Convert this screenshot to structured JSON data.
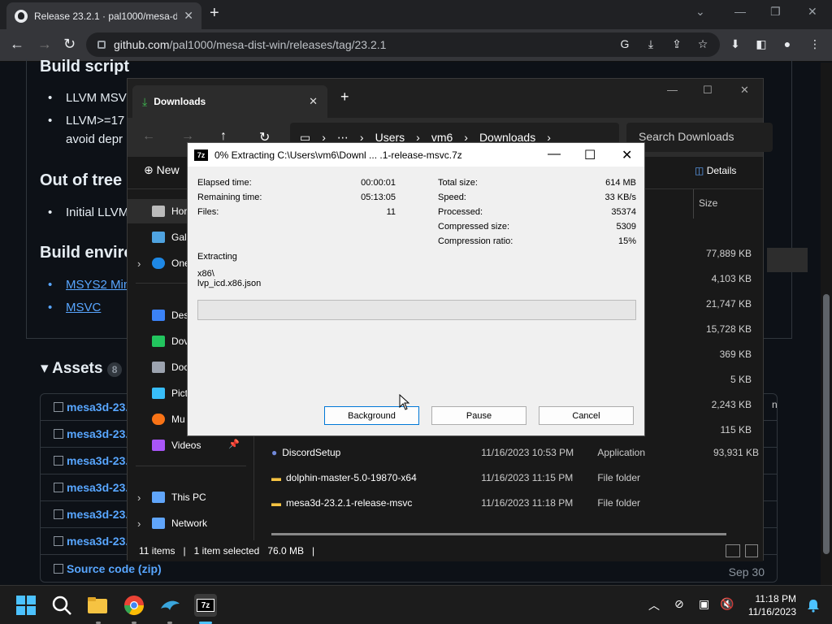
{
  "browser": {
    "tab_title": "Release 23.2.1 · pal1000/mesa-di",
    "url_host": "github.com",
    "url_path": "/pal1000/mesa-dist-win/releases/tag/23.2.1"
  },
  "github": {
    "build_script_heading": "Build script",
    "bullet1": "LLVM MSV",
    "bullet2a": "LLVM>=17",
    "bullet2b": "avoid depr",
    "out_of_tree_heading": "Out of tree",
    "bullet3": "Initial LLVM",
    "build_env_heading": "Build enviro",
    "link_msys2": "MSYS2 Min",
    "link_msvc": "MSVC",
    "assets_heading": "Assets",
    "assets_count": "8",
    "asset_rows": [
      "mesa3d-23.",
      "mesa3d-23.",
      "mesa3d-23.",
      "mesa3d-23.",
      "mesa3d-23.",
      "mesa3d-23."
    ],
    "source_code": "Source code (zip)",
    "date": "Sep 30"
  },
  "explorer": {
    "tab_label": "Downloads",
    "breadcrumbs": [
      "Users",
      "vm6",
      "Downloads"
    ],
    "search_placeholder": "Search Downloads",
    "new_label": "New",
    "details_label": "Details",
    "size_header": "Size",
    "nav": {
      "home": "Hor",
      "gallery": "Gall",
      "onedrive": "One",
      "desktop": "Des",
      "downloads": "Dov",
      "documents": "Doc",
      "pictures": "Pict",
      "music": "Mu",
      "videos": "Videos",
      "this_pc": "This PC",
      "network": "Network"
    },
    "sizes": [
      "77,889 KB",
      "4,103 KB",
      "21,747 KB",
      "15,728 KB",
      "369 KB",
      "5 KB",
      "2,243 KB",
      "115 KB"
    ],
    "partial_type": "n",
    "files": [
      {
        "name": "DiscordSetup",
        "date": "11/16/2023 10:53 PM",
        "type": "Application",
        "size": "93,931 KB"
      },
      {
        "name": "dolphin-master-5.0-19870-x64",
        "date": "11/16/2023 11:15 PM",
        "type": "File folder",
        "size": ""
      },
      {
        "name": "mesa3d-23.2.1-release-msvc",
        "date": "11/16/2023 11:18 PM",
        "type": "File folder",
        "size": ""
      }
    ],
    "status_items": "11 items",
    "status_selected": "1 item selected",
    "status_size": "76.0 MB"
  },
  "sevenzip": {
    "title": "0% Extracting C:\\Users\\vm6\\Downl ... .1-release-msvc.7z",
    "icon_text": "7z",
    "left": [
      {
        "k": "Elapsed time:",
        "v": "00:00:01"
      },
      {
        "k": "Remaining time:",
        "v": "05:13:05"
      },
      {
        "k": "Files:",
        "v": "11"
      }
    ],
    "right": [
      {
        "k": "Total size:",
        "v": "614 MB"
      },
      {
        "k": "Speed:",
        "v": "33 KB/s"
      },
      {
        "k": "Processed:",
        "v": "35374"
      },
      {
        "k": "Compressed size:",
        "v": "5309"
      },
      {
        "k": "Compression ratio:",
        "v": "15%"
      }
    ],
    "extracting_label": "Extracting",
    "path_line1": "x86\\",
    "path_line2": "lvp_icd.x86.json",
    "progress_fraction": 0,
    "btn_background": "Background",
    "btn_pause": "Pause",
    "btn_cancel": "Cancel"
  },
  "taskbar": {
    "time": "11:18 PM",
    "date": "11/16/2023",
    "sevenzip_icon": "7z"
  },
  "colors": {
    "github_link": "#58a6ff",
    "progress_green": "#06b025",
    "accent_blue": "#0078d7"
  }
}
